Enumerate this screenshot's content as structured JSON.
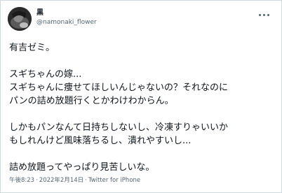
{
  "tweet": {
    "display_name": "黒",
    "handle": "@namonaki_flower",
    "lines": [
      "有吉ゼミ。",
      "",
      "スギちゃんの嫁...",
      "スギちゃんに痩せてほしいんじゃないの？それなのに",
      "パンの詰め放題行くとかわけわからん。",
      "",
      "しかもパンなんて日持ちしないし、冷凍すりゃいいか",
      "もしれんけど風味落ちるし、潰れやすいし...",
      "",
      "詰め放題ってやっぱり見苦しいな。"
    ],
    "time": "午後8:23",
    "date": "2022年2月14日",
    "source": "Twitter for iPhone",
    "separator": "·"
  },
  "icons": {
    "avatar": "profile-avatar",
    "more": "more-options-icon"
  },
  "colors": {
    "text": "#0f1419",
    "secondary": "#536471",
    "border": "#cfd9de"
  }
}
